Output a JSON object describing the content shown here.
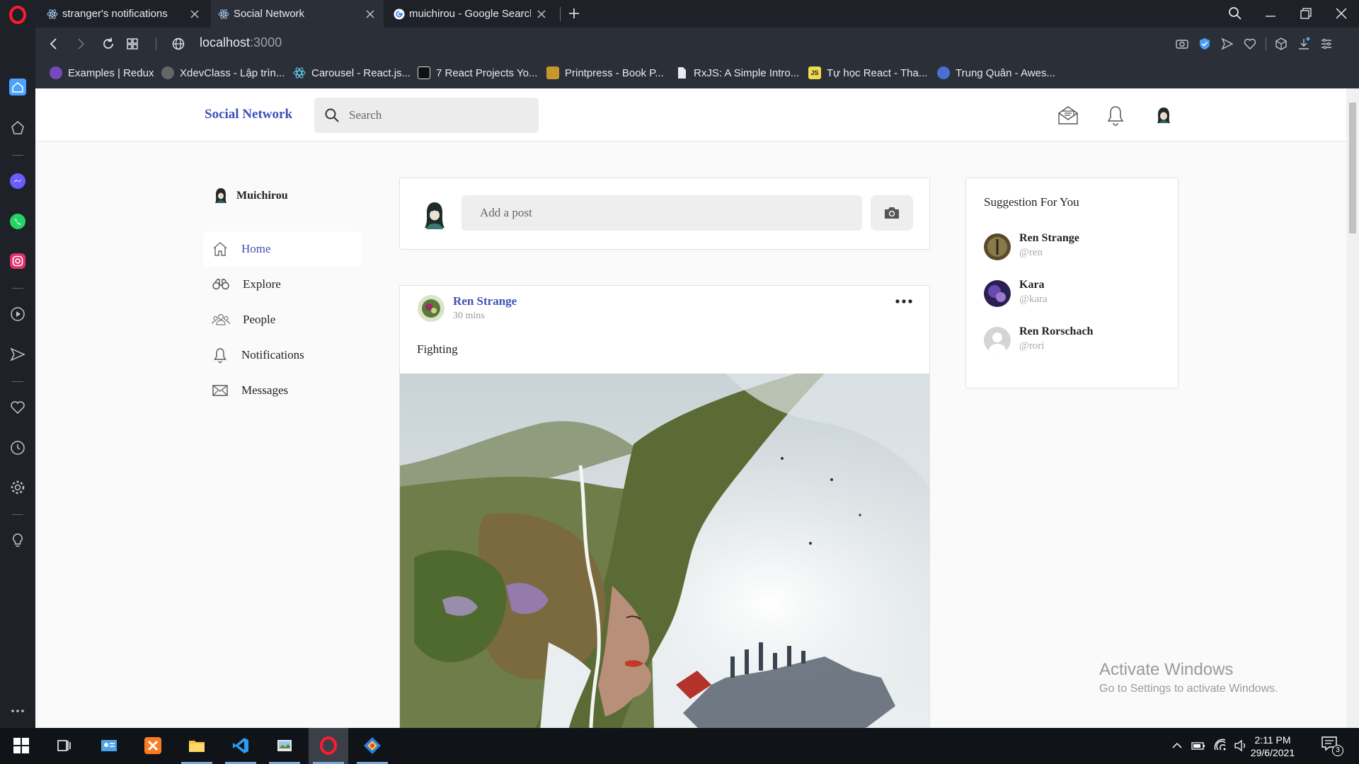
{
  "browser": {
    "tabs": [
      {
        "title": "stranger's notifications"
      },
      {
        "title": "Social Network"
      },
      {
        "title": "muichirou - Google Search"
      }
    ],
    "url_host": "localhost",
    "url_port": ":3000",
    "bookmarks": [
      {
        "label": "Examples | Redux",
        "color": "#764abc"
      },
      {
        "label": "XdevClass - Lập trìn...",
        "color": "#555555"
      },
      {
        "label": "Carousel - React.js...",
        "color": "#61dafb"
      },
      {
        "label": "7 React Projects Yo...",
        "color": "#222222"
      },
      {
        "label": "Printpress - Book P...",
        "color": "#c8962e"
      },
      {
        "label": "RxJS: A Simple Intro...",
        "color": "#e8eaed"
      },
      {
        "label": "Tự học React - Tha...",
        "color": "#f0db4f"
      },
      {
        "label": "Trung Quân - Awes...",
        "color": "#4a6fd1"
      }
    ]
  },
  "app": {
    "brand": "Social Network",
    "search_placeholder": "Search",
    "user_name": "Muichirou",
    "menu": [
      {
        "label": "Home",
        "icon": "home-icon",
        "active": true
      },
      {
        "label": "Explore",
        "icon": "binoculars-icon"
      },
      {
        "label": "People",
        "icon": "people-icon"
      },
      {
        "label": "Notifications",
        "icon": "bell-icon"
      },
      {
        "label": "Messages",
        "icon": "envelope-icon"
      }
    ],
    "add_post_placeholder": "Add a post",
    "post": {
      "author": "Ren Strange",
      "time": "30 mins",
      "text": "Fighting"
    },
    "suggestions_title": "Suggestion For You",
    "suggestions": [
      {
        "name": "Ren Strange",
        "handle": "@ren"
      },
      {
        "name": "Kara",
        "handle": "@kara"
      },
      {
        "name": "Ren Rorschach",
        "handle": "@rori"
      }
    ],
    "accent_color": "#3f51b5"
  },
  "windows": {
    "activate_title": "Activate Windows",
    "activate_sub": "Go to Settings to activate Windows.",
    "time": "2:11 PM",
    "date": "29/6/2021",
    "notification_count": "3"
  }
}
